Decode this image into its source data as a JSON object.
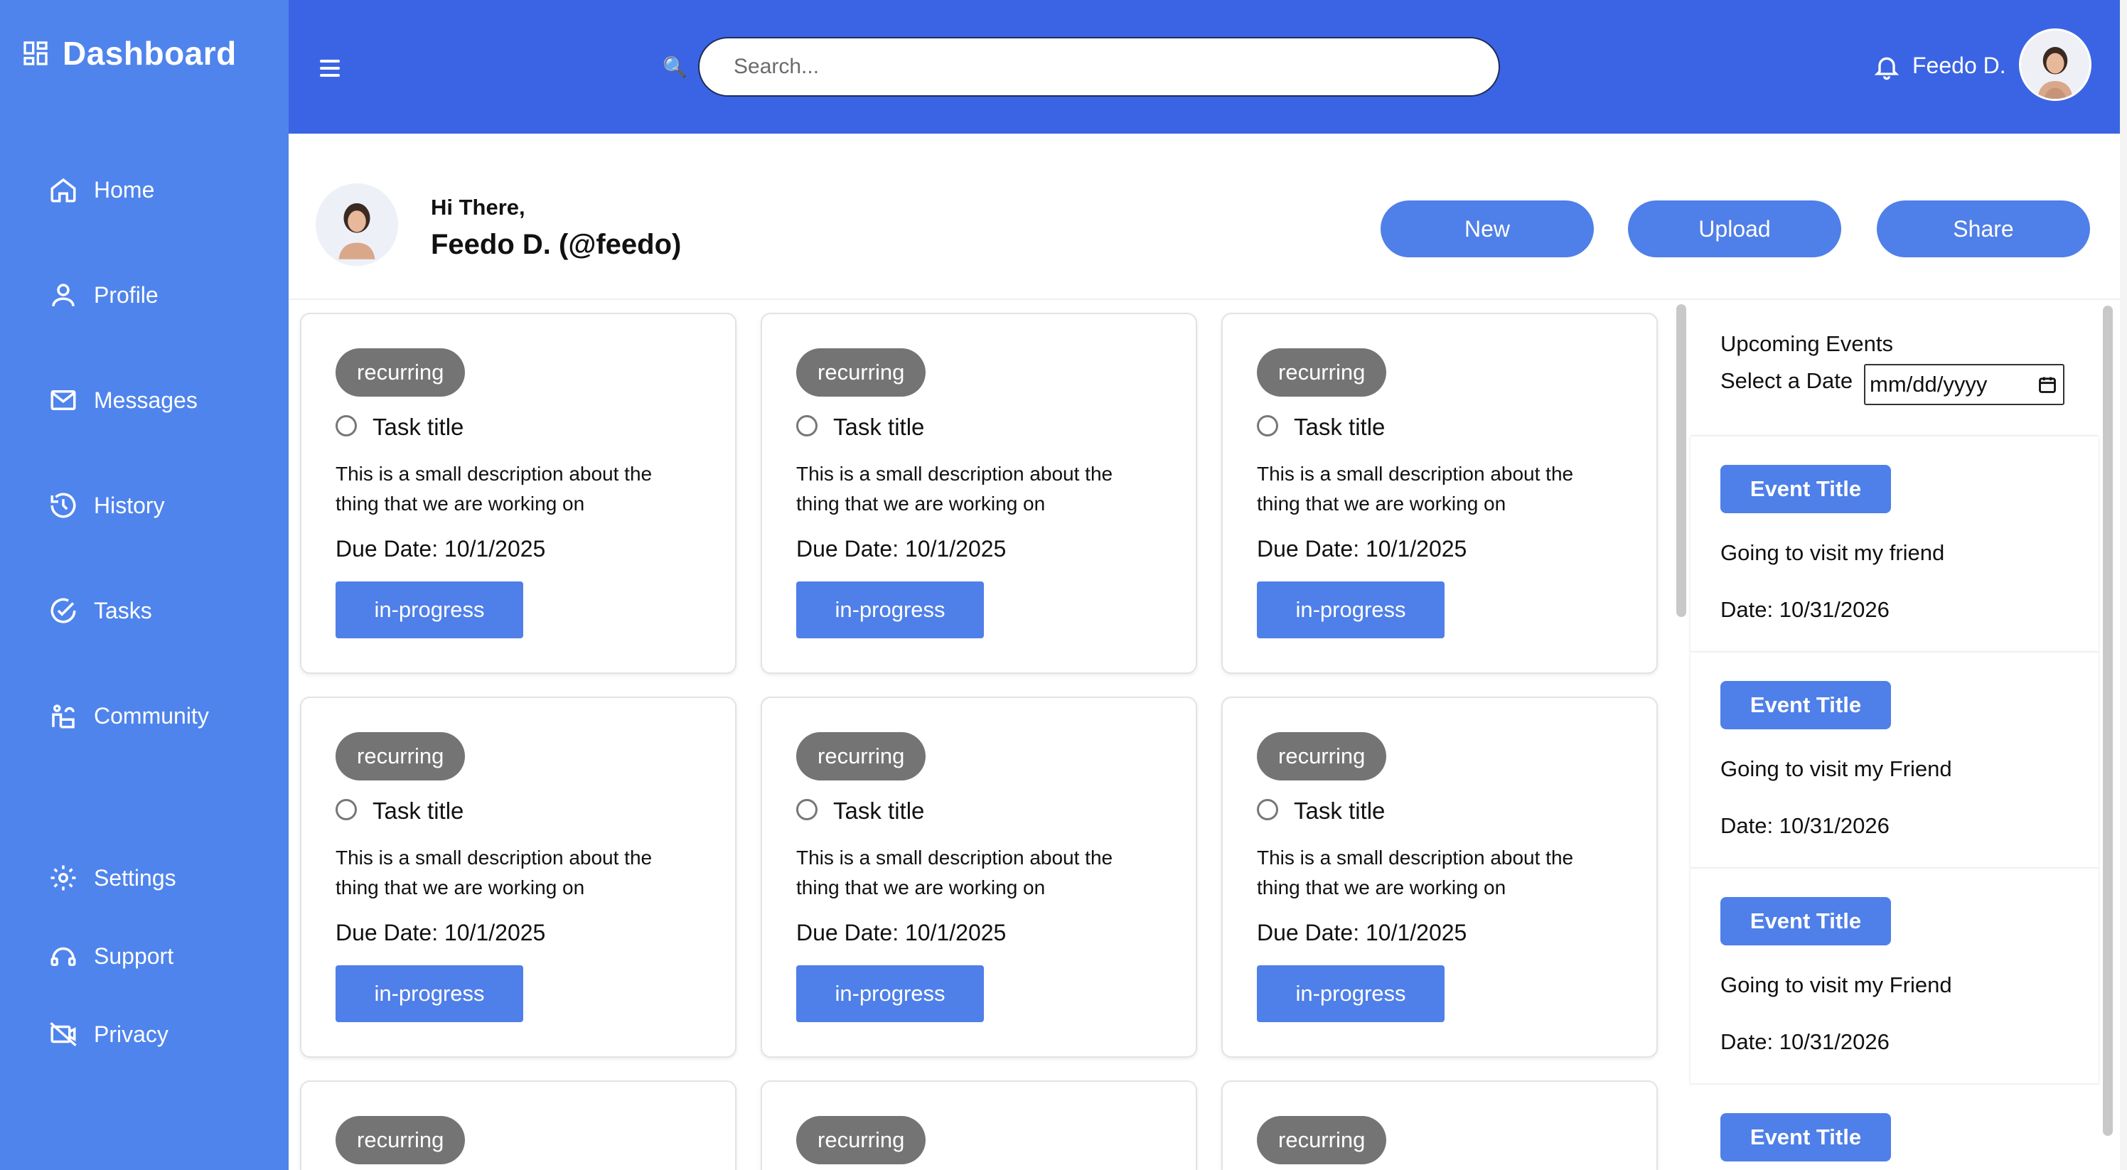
{
  "sidebar": {
    "brand": "Dashboard",
    "items": [
      {
        "label": "Home",
        "icon": "home-icon"
      },
      {
        "label": "Profile",
        "icon": "user-icon"
      },
      {
        "label": "Messages",
        "icon": "mail-icon"
      },
      {
        "label": "History",
        "icon": "history-icon"
      },
      {
        "label": "Tasks",
        "icon": "check-circle-icon"
      },
      {
        "label": "Community",
        "icon": "community-icon"
      }
    ],
    "bottom_items": [
      {
        "label": "Settings",
        "icon": "gear-icon"
      },
      {
        "label": "Support",
        "icon": "support-icon"
      },
      {
        "label": "Privacy",
        "icon": "privacy-icon"
      }
    ]
  },
  "topbar": {
    "search_placeholder": "Search...",
    "user_name": "Feedo D."
  },
  "greeting": {
    "hi": "Hi There,",
    "name": "Feedo D. (@feedo)"
  },
  "actions": {
    "new": "New",
    "upload": "Upload",
    "share": "Share"
  },
  "tasks": [
    {
      "tag": "recurring",
      "title": "Task title",
      "desc_line1": "This is a small description about the",
      "desc_line2": "thing that we are working on",
      "due": "Due Date: 10/1/2025",
      "status": "in-progress"
    },
    {
      "tag": "recurring",
      "title": "Task title",
      "desc_line1": "This is a small description about the",
      "desc_line2": "thing that we are working on",
      "due": "Due Date: 10/1/2025",
      "status": "in-progress"
    },
    {
      "tag": "recurring",
      "title": "Task title",
      "desc_line1": "This is a small description about the",
      "desc_line2": "thing that we are working on",
      "due": "Due Date: 10/1/2025",
      "status": "in-progress"
    },
    {
      "tag": "recurring",
      "title": "Task title",
      "desc_line1": "This is a small description about the",
      "desc_line2": "thing that we are working on",
      "due": "Due Date: 10/1/2025",
      "status": "in-progress"
    },
    {
      "tag": "recurring",
      "title": "Task title",
      "desc_line1": "This is a small description about the",
      "desc_line2": "thing that we are working on",
      "due": "Due Date: 10/1/2025",
      "status": "in-progress"
    },
    {
      "tag": "recurring",
      "title": "Task title",
      "desc_line1": "This is a small description about the",
      "desc_line2": "thing that we are working on",
      "due": "Due Date: 10/1/2025",
      "status": "in-progress"
    }
  ],
  "partial_tasks": [
    {
      "tag": "recurring"
    },
    {
      "tag": "recurring"
    },
    {
      "tag": "recurring"
    }
  ],
  "events": {
    "title": "Upcoming Events",
    "date_label": "Select a Date",
    "date_value": "mm/dd/yyyy",
    "items": [
      {
        "title": "Event Title",
        "desc": "Going to visit my friend",
        "date": "Date: 10/31/2026"
      },
      {
        "title": "Event Title",
        "desc": "Going to visit my Friend",
        "date": "Date: 10/31/2026"
      },
      {
        "title": "Event Title",
        "desc": "Going to visit my Friend",
        "date": "Date: 10/31/2026"
      },
      {
        "title": "Event Title"
      }
    ]
  },
  "colors": {
    "sidebar": "#4f84ec",
    "topbar": "#3b64e4",
    "accent": "#4f7fe8",
    "pill": "#747474"
  }
}
